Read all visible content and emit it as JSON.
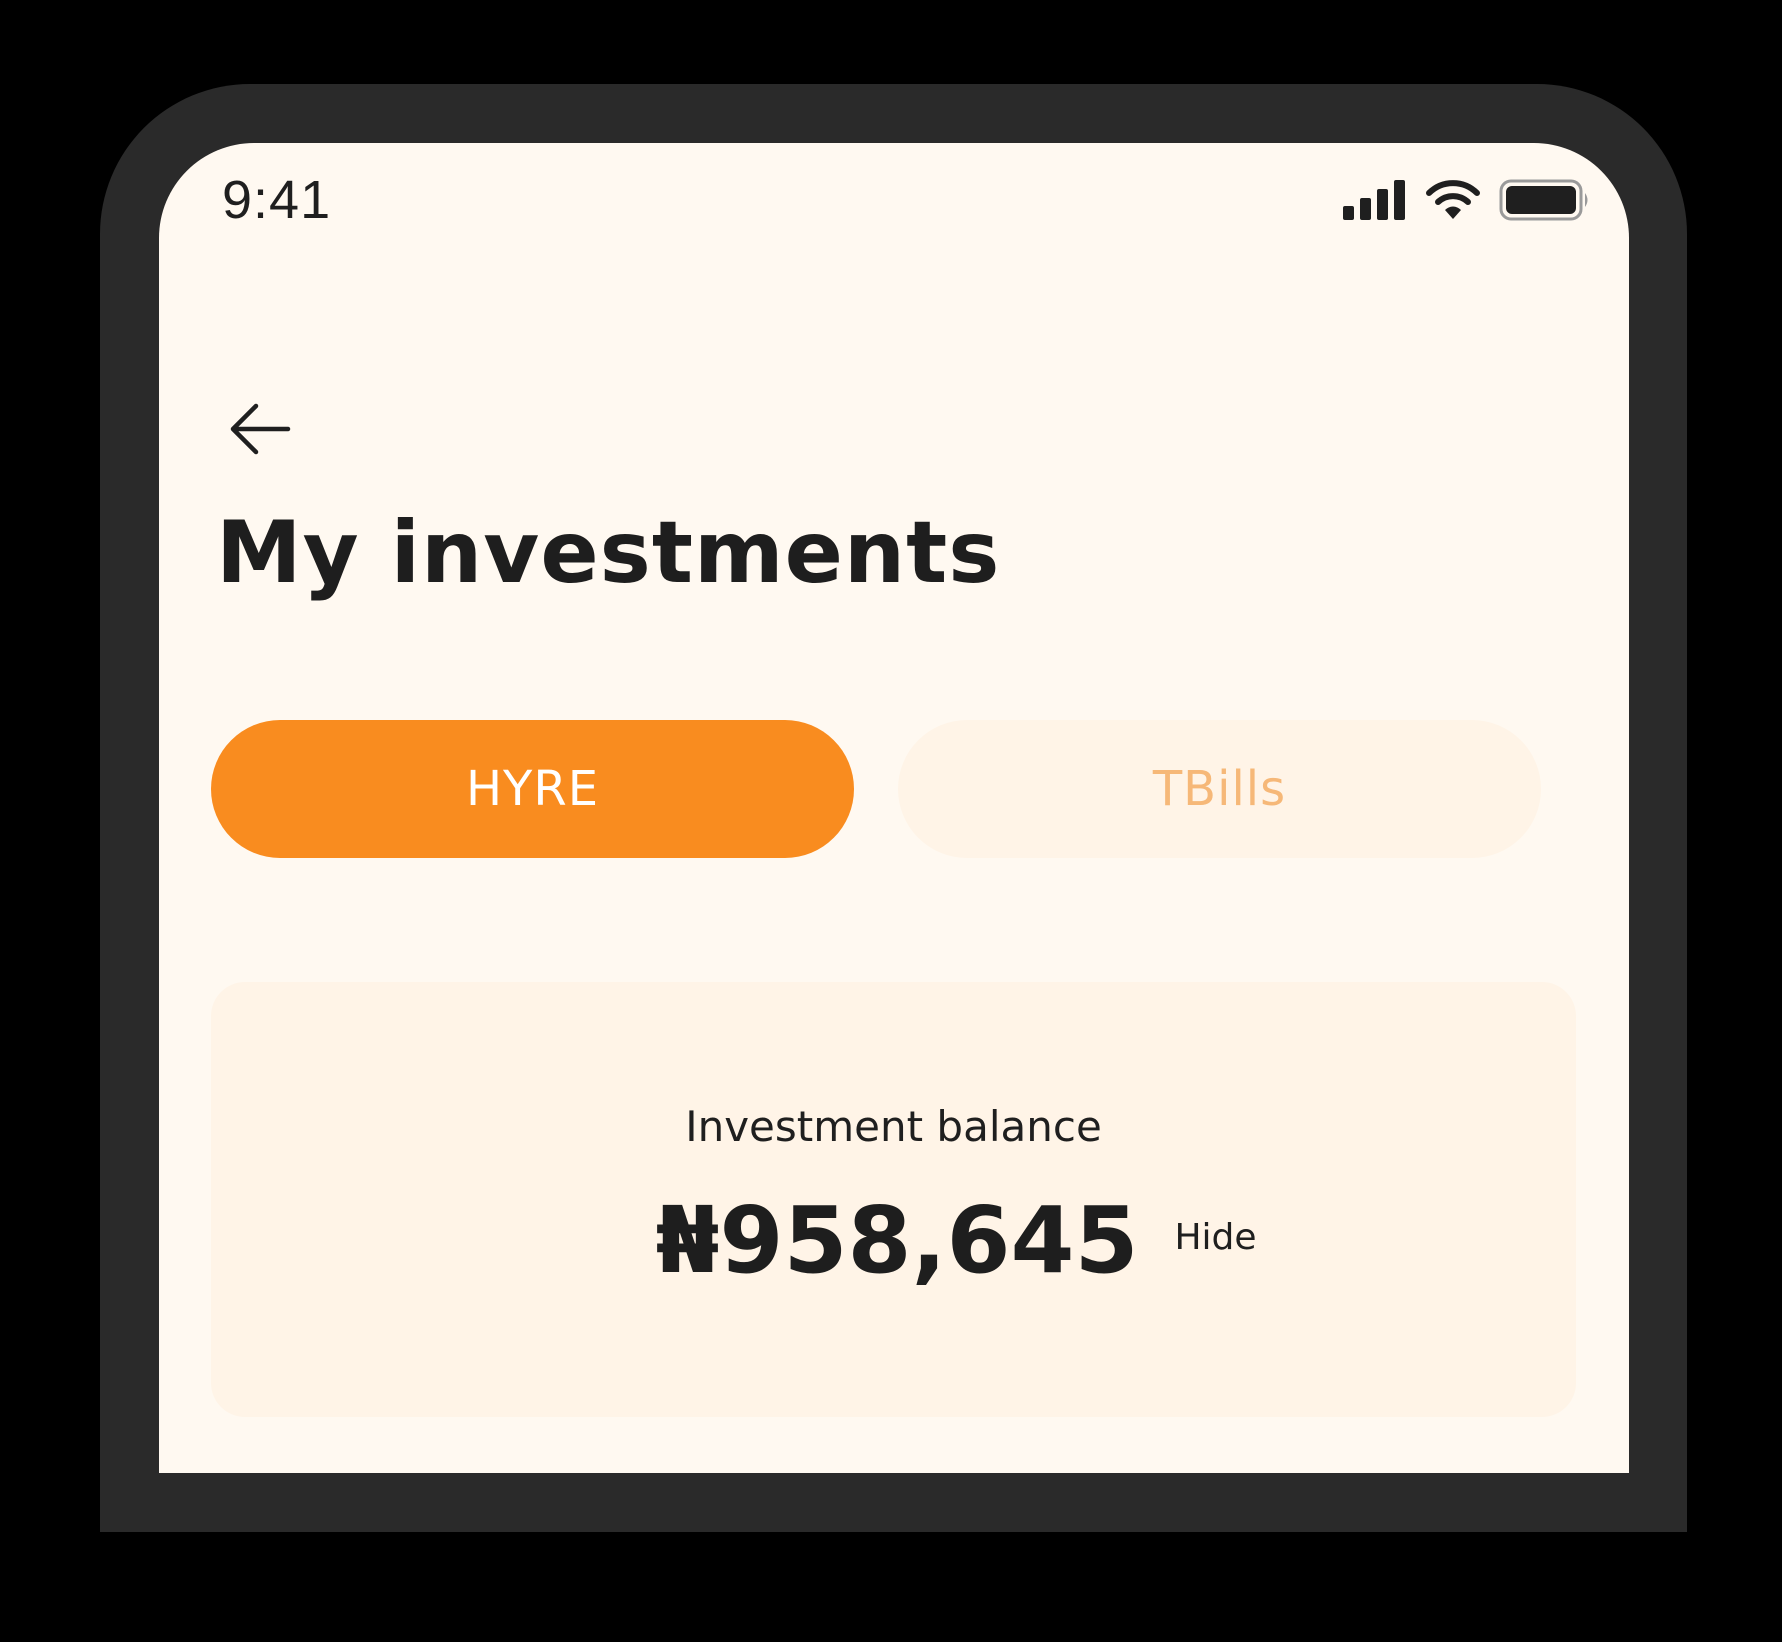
{
  "status_bar": {
    "time": "9:41",
    "icons": [
      "cellular-signal-icon",
      "wifi-icon",
      "battery-icon"
    ]
  },
  "header": {
    "back_icon": "arrow-left-icon",
    "title": "My investments"
  },
  "tabs": [
    {
      "label": "HYRE",
      "selected": true
    },
    {
      "label": "TBills",
      "selected": false
    }
  ],
  "balance_card": {
    "label": "Investment balance",
    "amount": "₦958,645",
    "hide_label": "Hide"
  },
  "colors": {
    "accent": "#f98c1f",
    "background": "#fff9f1",
    "card": "#fff4e7",
    "inactive_tab_text": "#f6b878",
    "text": "#1e1e1e",
    "frame": "#2a2a2a"
  }
}
